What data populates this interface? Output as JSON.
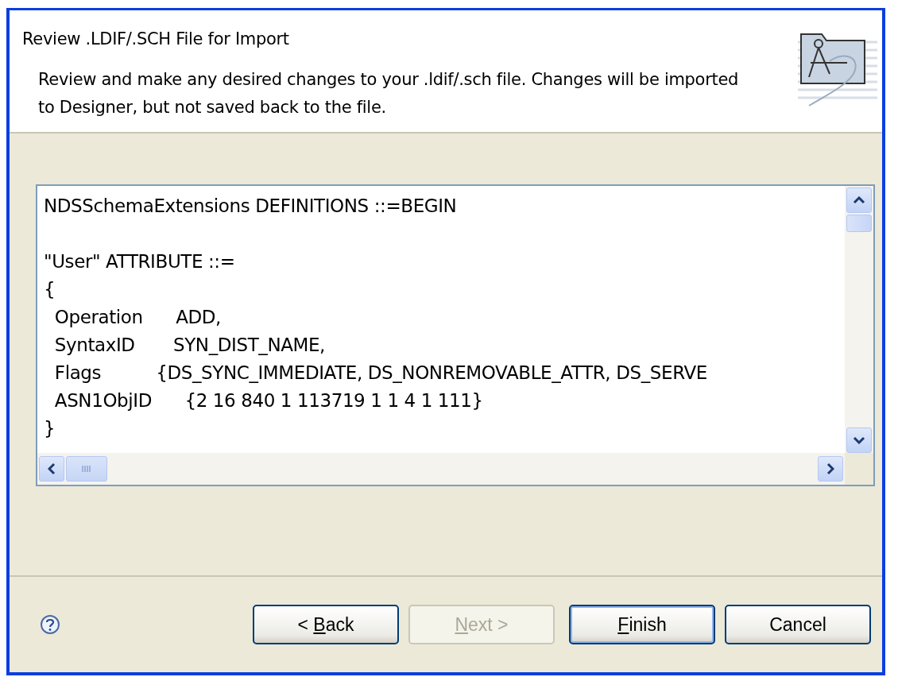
{
  "header": {
    "title": "Review .LDIF/.SCH File for Import",
    "description": "Review and make any desired changes to your .ldif/.sch file.  Changes will be imported to Designer, but not saved back to the file."
  },
  "editor": {
    "lines": [
      {
        "kind": "text",
        "text": "NDSSchemaExtensions DEFINITIONS ::=BEGIN"
      },
      {
        "kind": "blank"
      },
      {
        "kind": "text",
        "text": "\"User\" ATTRIBUTE ::="
      },
      {
        "kind": "text",
        "text": "{"
      },
      {
        "kind": "text",
        "text": "  Operation      ADD,"
      },
      {
        "kind": "text",
        "text": "  SyntaxID       SYN_DIST_NAME,"
      },
      {
        "kind": "text",
        "text": "  Flags          {DS_SYNC_IMMEDIATE, DS_NONREMOVABLE_ATTR, DS_SERVE"
      },
      {
        "kind": "text",
        "text": "  ASN1ObjID      {2 16 840 1 113719 1 1 4 1 111}"
      },
      {
        "kind": "text",
        "text": "}"
      }
    ]
  },
  "buttons": [
    {
      "pre": "< ",
      "key": "B",
      "post": "ack",
      "disabled": false,
      "default": false
    },
    {
      "key": "N",
      "post": "ext >",
      "disabled": true,
      "default": false
    },
    {
      "key": "F",
      "post": "inish",
      "disabled": false,
      "default": true
    },
    {
      "post": "Cancel",
      "disabled": false,
      "default": false
    }
  ]
}
